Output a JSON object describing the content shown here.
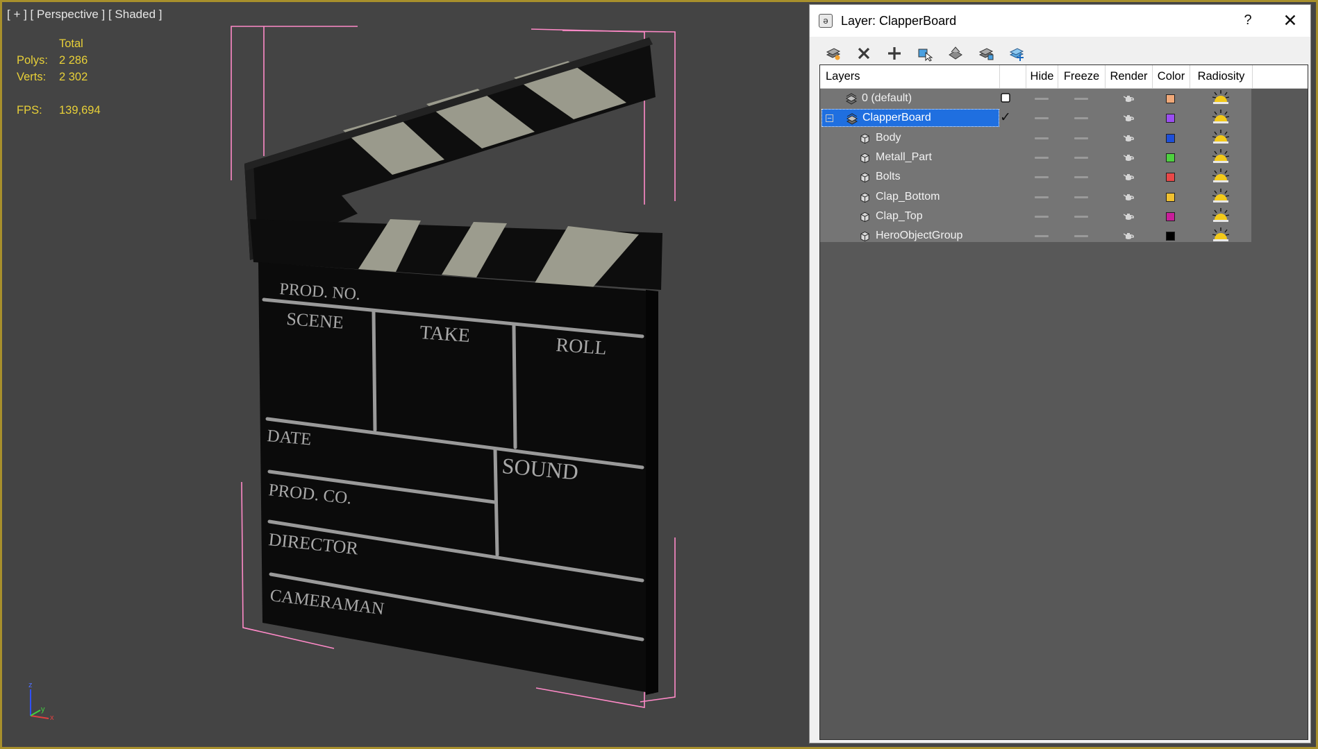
{
  "viewport": {
    "label": "[ + ] [ Perspective ] [ Shaded ]",
    "stats": {
      "total_label": "Total",
      "polys_label": "Polys:",
      "polys_value": "2 286",
      "verts_label": "Verts:",
      "verts_value": "2 302",
      "fps_label": "FPS:",
      "fps_value": "139,694"
    },
    "clapperboard_text": {
      "prod_no": "PROD. NO.",
      "scene": "SCENE",
      "take": "TAKE",
      "roll": "ROLL",
      "date": "DATE",
      "sound": "SOUND",
      "prod_co": "PROD. CO.",
      "director": "DIRECTOR",
      "cameraman": "CAMERAMAN"
    },
    "axis": {
      "z": "z",
      "x": "x",
      "y": "y"
    }
  },
  "dialog": {
    "title": "Layer: ClapperBoard",
    "help_label": "?",
    "close_label": "✕",
    "toolbar": [
      {
        "name": "create-layer-button",
        "icon": "new-layer-icon"
      },
      {
        "name": "delete-layer-button",
        "icon": "delete-x-icon"
      },
      {
        "name": "add-to-layer-button",
        "icon": "plus-icon"
      },
      {
        "name": "select-objects-button",
        "icon": "select-objects-icon"
      },
      {
        "name": "highlight-layer-button",
        "icon": "highlight-layer-icon"
      },
      {
        "name": "hide-layers-button",
        "icon": "hide-layers-icon"
      },
      {
        "name": "freeze-layers-button",
        "icon": "freeze-layers-icon"
      }
    ],
    "columns": [
      "Layers",
      "Hide",
      "Freeze",
      "Render",
      "Color",
      "Radiosity"
    ],
    "rows": [
      {
        "label": "0 (default)",
        "kind": "layer",
        "color": "#f0a878",
        "active": false,
        "selected": false
      },
      {
        "label": "ClapperBoard",
        "kind": "layer",
        "color": "#9a4ef0",
        "active": true,
        "selected": true,
        "expanded": true
      },
      {
        "label": "Body",
        "kind": "object",
        "color": "#1f4fd8",
        "active": false,
        "selected": false
      },
      {
        "label": "Metall_Part",
        "kind": "object",
        "color": "#4ed040",
        "active": false,
        "selected": false
      },
      {
        "label": "Bolts",
        "kind": "object",
        "color": "#e84848",
        "active": false,
        "selected": false
      },
      {
        "label": "Clap_Bottom",
        "kind": "object",
        "color": "#f0c030",
        "active": false,
        "selected": false
      },
      {
        "label": "Clap_Top",
        "kind": "object",
        "color": "#c81e9a",
        "active": false,
        "selected": false
      },
      {
        "label": "HeroObjectGroup",
        "kind": "object",
        "color": "#000000",
        "active": false,
        "selected": false
      }
    ],
    "expander_label": "−",
    "active_check": "✓"
  }
}
